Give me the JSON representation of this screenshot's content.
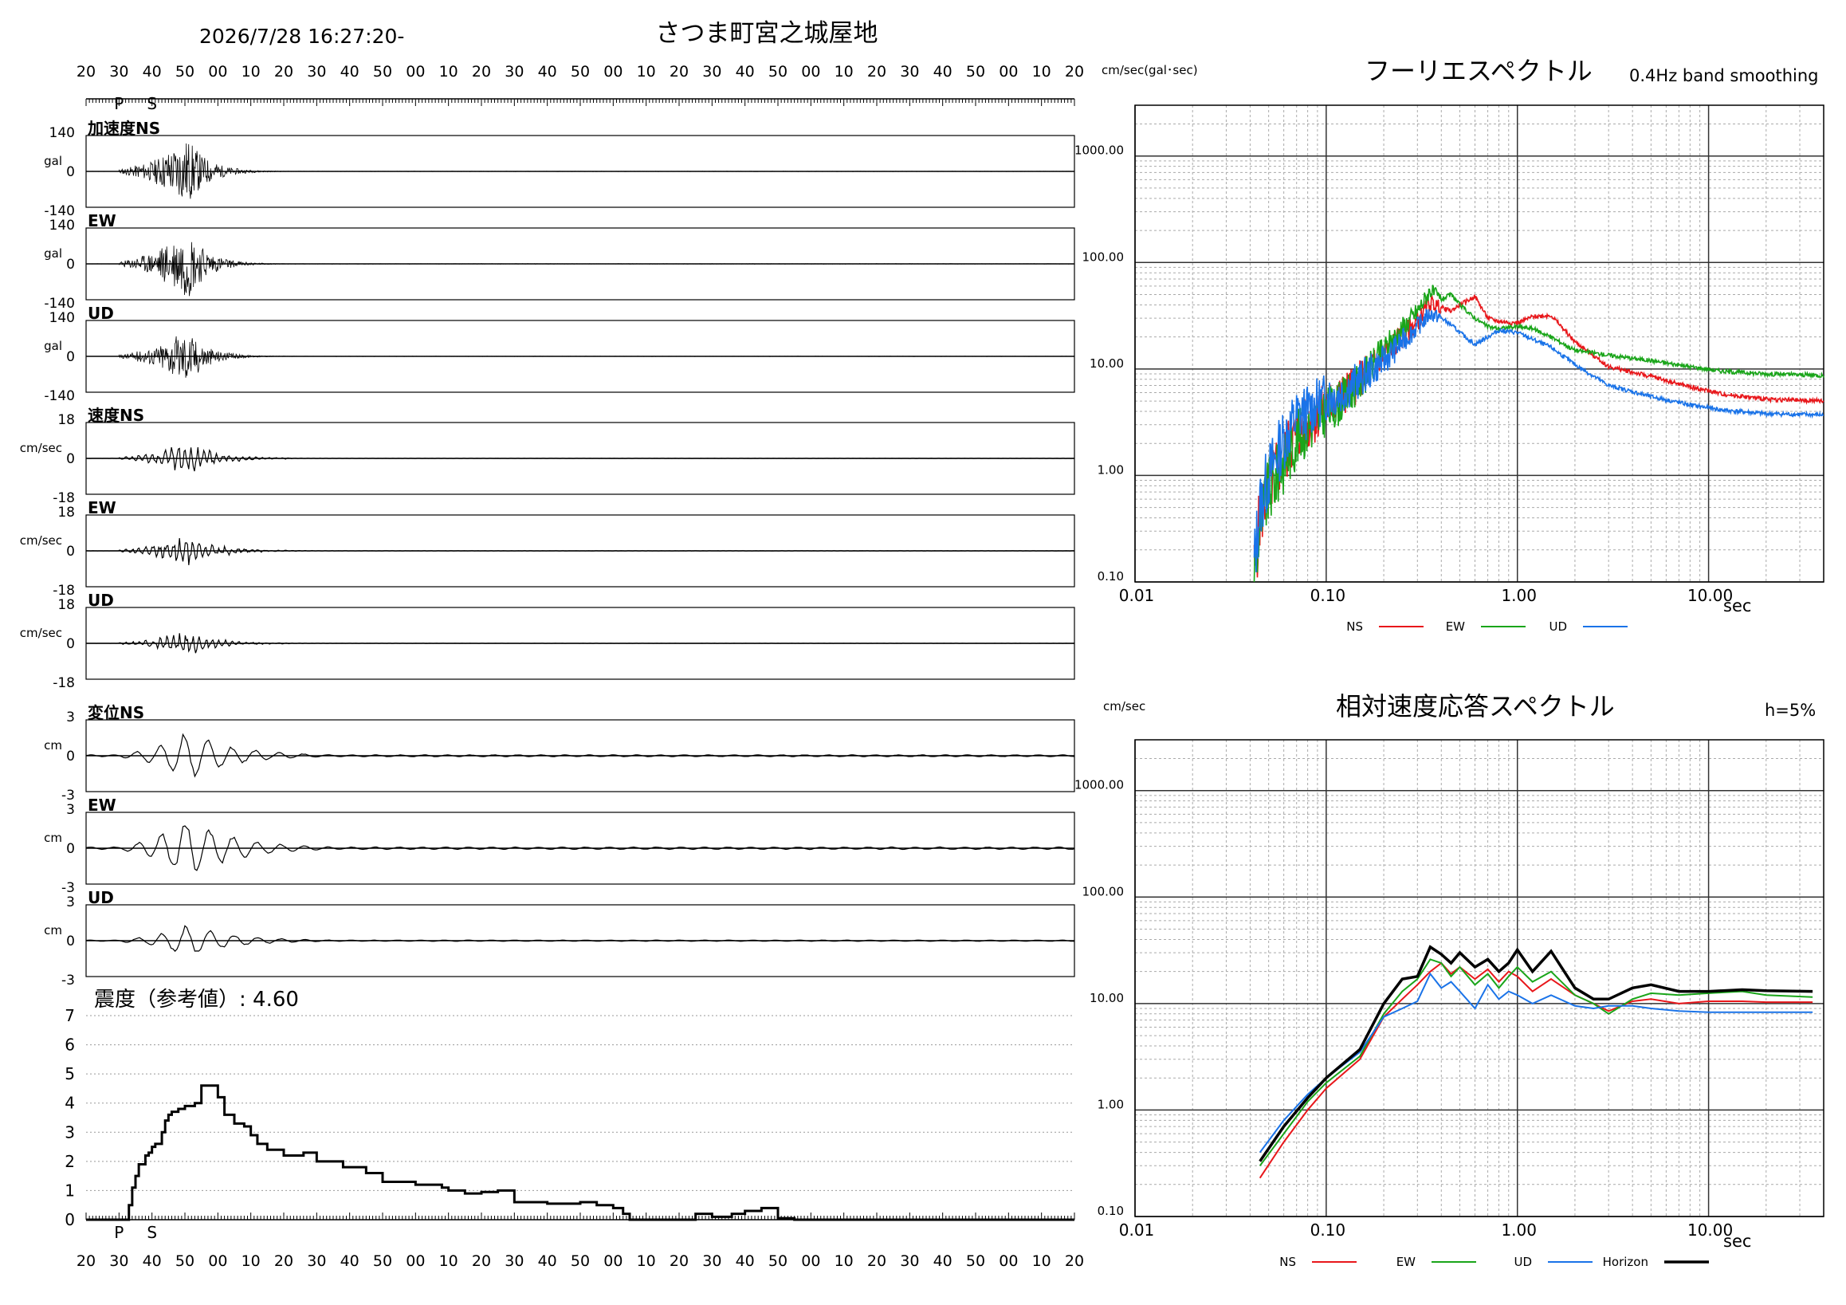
{
  "header": {
    "datetime": "2026/7/28 16:27:20-",
    "station": "さつま町宮之城屋地"
  },
  "colors": {
    "ns": "#e8171b",
    "ew": "#1aa51a",
    "ud": "#1a73e8",
    "horizon": "#000000",
    "ps_marker": "#1a73e8"
  },
  "time_axis": {
    "ticks": [
      "20",
      "30",
      "40",
      "50",
      "00",
      "10",
      "20",
      "30",
      "40",
      "50",
      "00",
      "10",
      "20",
      "30",
      "40",
      "50",
      "00",
      "10",
      "20",
      "30",
      "40",
      "50",
      "00",
      "10",
      "20",
      "30",
      "40",
      "50",
      "00",
      "10",
      "20"
    ],
    "p_label": "P",
    "s_label": "S"
  },
  "chart_data": [
    {
      "type": "line",
      "id": "waveforms",
      "panels": [
        {
          "label": "加速度NS",
          "unit": "gal",
          "max": "140",
          "zero": "0",
          "min": "-140",
          "kind": "acc",
          "amp": 1.0,
          "seed": 11
        },
        {
          "label": "EW",
          "unit": "gal",
          "max": "140",
          "zero": "0",
          "min": "-140",
          "kind": "acc",
          "amp": 1.05,
          "seed": 23
        },
        {
          "label": "UD",
          "unit": "gal",
          "max": "140",
          "zero": "0",
          "min": "-140",
          "kind": "acc",
          "amp": 0.8,
          "seed": 37
        },
        {
          "label": "速度NS",
          "unit": "cm/sec",
          "max": "18",
          "zero": "0",
          "min": "-18",
          "kind": "vel",
          "amp": 0.55,
          "seed": 41
        },
        {
          "label": "EW",
          "unit": "cm/sec",
          "max": "18",
          "zero": "0",
          "min": "-18",
          "kind": "vel",
          "amp": 0.55,
          "seed": 53
        },
        {
          "label": "UD",
          "unit": "cm/sec",
          "max": "18",
          "zero": "0",
          "min": "-18",
          "kind": "vel",
          "amp": 0.4,
          "seed": 67
        },
        {
          "label": "変位NS",
          "unit": "cm",
          "max": "3",
          "zero": "0",
          "min": "-3",
          "kind": "disp",
          "amp": 0.75,
          "seed": 71
        },
        {
          "label": "EW",
          "unit": "cm",
          "max": "3",
          "zero": "0",
          "min": "-3",
          "kind": "disp",
          "amp": 0.95,
          "seed": 83
        },
        {
          "label": "UD",
          "unit": "cm",
          "max": "3",
          "zero": "0",
          "min": "-3",
          "kind": "disp",
          "amp": 0.5,
          "seed": 97
        }
      ]
    },
    {
      "type": "line",
      "id": "intensity",
      "title": "震度（参考値）: 4.60",
      "ylim": [
        0,
        7
      ],
      "yticks": [
        "0",
        "1",
        "2",
        "3",
        "4",
        "5",
        "6",
        "7"
      ],
      "x_seconds": [
        0,
        11,
        13,
        14,
        15,
        16,
        18,
        19,
        20,
        21,
        22,
        23,
        24,
        25,
        26,
        28,
        30,
        33,
        35,
        36,
        37,
        40,
        42,
        45,
        48,
        50,
        52,
        55,
        60,
        66,
        70,
        78,
        85,
        90,
        100,
        108,
        110,
        115,
        120,
        125,
        130,
        140,
        150,
        155,
        160,
        163,
        165,
        170,
        175,
        180,
        185,
        190,
        196,
        200,
        205,
        210,
        215,
        220,
        300
      ],
      "values": [
        0,
        0,
        0.5,
        1.1,
        1.5,
        1.9,
        2.2,
        2.3,
        2.5,
        2.6,
        2.6,
        3.0,
        3.4,
        3.6,
        3.7,
        3.8,
        3.9,
        4.0,
        4.6,
        4.6,
        4.6,
        4.2,
        3.6,
        3.3,
        3.2,
        2.9,
        2.6,
        2.4,
        2.2,
        2.3,
        2.0,
        1.8,
        1.6,
        1.3,
        1.2,
        1.1,
        1.0,
        0.9,
        0.95,
        1.0,
        0.6,
        0.55,
        0.6,
        0.5,
        0.4,
        0.2,
        0.0,
        0.0,
        0.0,
        0.0,
        0.2,
        0.1,
        0.2,
        0.3,
        0.4,
        0.05,
        0.0,
        0.0,
        0.0
      ]
    },
    {
      "type": "line",
      "id": "fourier",
      "title": "フーリエスペクトル",
      "subtitle": "0.4Hz band smoothing",
      "ylabel": "cm/sec(gal･sec)",
      "xlabel": "sec",
      "log_x": true,
      "log_y": true,
      "xlim": [
        0.01,
        40
      ],
      "ylim": [
        0.1,
        3000
      ],
      "xticks": [
        {
          "v": 0.01,
          "label": "0.01"
        },
        {
          "v": 0.1,
          "label": "0.10"
        },
        {
          "v": 1,
          "label": "1.00"
        },
        {
          "v": 10,
          "label": "10.00"
        }
      ],
      "yticks": [
        {
          "v": 0.1,
          "label": "0.10"
        },
        {
          "v": 1,
          "label": "1.00"
        },
        {
          "v": 10,
          "label": "10.00"
        },
        {
          "v": 100,
          "label": "100.00"
        },
        {
          "v": 1000,
          "label": "1000.00"
        }
      ],
      "series": [
        {
          "name": "NS",
          "color": "#e8171b",
          "noise": 0.35,
          "seed": 5,
          "x": [
            0.042,
            0.045,
            0.05,
            0.06,
            0.07,
            0.08,
            0.1,
            0.12,
            0.15,
            0.2,
            0.25,
            0.3,
            0.35,
            0.4,
            0.45,
            0.5,
            0.6,
            0.7,
            0.8,
            1.0,
            1.2,
            1.5,
            2.0,
            3.0,
            5.0,
            8.0,
            12.0,
            20.0,
            40.0
          ],
          "y": [
            0.12,
            0.4,
            0.8,
            1.5,
            2.5,
            3.0,
            4.5,
            5.5,
            8.0,
            14,
            20,
            28,
            42,
            38,
            35,
            40,
            48,
            30,
            28,
            27,
            31,
            32,
            18,
            10.5,
            8.5,
            6.8,
            5.8,
            5.2,
            5.0
          ]
        },
        {
          "name": "EW",
          "color": "#1aa51a",
          "noise": 0.35,
          "seed": 9,
          "x": [
            0.042,
            0.045,
            0.05,
            0.06,
            0.07,
            0.08,
            0.1,
            0.12,
            0.15,
            0.2,
            0.25,
            0.3,
            0.35,
            0.4,
            0.45,
            0.5,
            0.6,
            0.7,
            0.8,
            1.0,
            1.2,
            1.5,
            2.0,
            3.0,
            5.0,
            8.0,
            12.0,
            20.0,
            40.0
          ],
          "y": [
            0.12,
            0.35,
            0.7,
            1.3,
            2.2,
            2.8,
            4.0,
            5.0,
            7.5,
            15,
            24,
            35,
            55,
            45,
            50,
            40,
            30,
            25,
            24,
            25,
            24,
            20,
            15,
            13.5,
            12,
            10.5,
            9.5,
            9.0,
            8.7
          ]
        },
        {
          "name": "UD",
          "color": "#1a73e8",
          "noise": 0.35,
          "seed": 13,
          "x": [
            0.042,
            0.045,
            0.05,
            0.06,
            0.07,
            0.08,
            0.1,
            0.12,
            0.15,
            0.2,
            0.25,
            0.3,
            0.35,
            0.4,
            0.45,
            0.5,
            0.6,
            0.7,
            0.8,
            1.0,
            1.2,
            1.5,
            2.0,
            3.0,
            5.0,
            8.0,
            12.0,
            20.0,
            40.0
          ],
          "y": [
            0.15,
            0.5,
            1.0,
            2.2,
            3.5,
            4.0,
            5.5,
            6.0,
            8.0,
            12,
            18,
            25,
            33,
            30,
            26,
            22,
            17,
            20,
            23,
            22,
            19,
            16,
            11,
            7,
            5.5,
            4.6,
            4.1,
            3.8,
            3.7
          ]
        }
      ]
    },
    {
      "type": "line",
      "id": "response",
      "title": "相対速度応答スペクトル",
      "subtitle": "h=5%",
      "ylabel": "cm/sec",
      "xlabel": "sec",
      "log_x": true,
      "log_y": true,
      "xlim": [
        0.01,
        40
      ],
      "ylim": [
        0.1,
        3000
      ],
      "xticks": [
        {
          "v": 0.01,
          "label": "0.01"
        },
        {
          "v": 0.1,
          "label": "0.10"
        },
        {
          "v": 1,
          "label": "1.00"
        },
        {
          "v": 10,
          "label": "10.00"
        }
      ],
      "yticks": [
        {
          "v": 0.1,
          "label": "0.10"
        },
        {
          "v": 1,
          "label": "1.00"
        },
        {
          "v": 10,
          "label": "10.00"
        },
        {
          "v": 100,
          "label": "100.00"
        },
        {
          "v": 1000,
          "label": "1000.00"
        }
      ],
      "series": [
        {
          "name": "NS",
          "color": "#e8171b",
          "width": 2,
          "x": [
            0.045,
            0.06,
            0.08,
            0.1,
            0.15,
            0.2,
            0.25,
            0.3,
            0.35,
            0.4,
            0.45,
            0.5,
            0.6,
            0.7,
            0.8,
            0.9,
            1.0,
            1.2,
            1.5,
            2.0,
            2.5,
            3.0,
            4.0,
            5.0,
            7.0,
            10.0,
            15.0,
            20.0,
            35.0
          ],
          "y": [
            0.23,
            0.5,
            1.0,
            1.6,
            3.0,
            7.5,
            11,
            15,
            20,
            24,
            19,
            22,
            17,
            21,
            16,
            20,
            18,
            13,
            17,
            12,
            10,
            8.5,
            10.5,
            11,
            10,
            10.5,
            10.5,
            10.3,
            10.3
          ]
        },
        {
          "name": "EW",
          "color": "#1aa51a",
          "width": 2,
          "x": [
            0.045,
            0.06,
            0.08,
            0.1,
            0.15,
            0.2,
            0.25,
            0.3,
            0.35,
            0.4,
            0.45,
            0.5,
            0.6,
            0.7,
            0.8,
            0.9,
            1.0,
            1.2,
            1.5,
            2.0,
            2.5,
            3.0,
            4.0,
            5.0,
            7.0,
            10.0,
            15.0,
            20.0,
            35.0
          ],
          "y": [
            0.3,
            0.6,
            1.2,
            1.8,
            3.2,
            8.0,
            13,
            17,
            26,
            24,
            18,
            22,
            15,
            19,
            14,
            18,
            22,
            16,
            20,
            12,
            10,
            8.0,
            11,
            12.5,
            12,
            12.5,
            13,
            12,
            11.5
          ]
        },
        {
          "name": "UD",
          "color": "#1a73e8",
          "width": 2,
          "x": [
            0.045,
            0.06,
            0.08,
            0.1,
            0.15,
            0.2,
            0.25,
            0.3,
            0.35,
            0.4,
            0.45,
            0.5,
            0.6,
            0.7,
            0.8,
            0.9,
            1.0,
            1.2,
            1.5,
            2.0,
            2.5,
            3.0,
            4.0,
            5.0,
            7.0,
            10.0,
            15.0,
            20.0,
            35.0
          ],
          "y": [
            0.4,
            0.8,
            1.4,
            2.0,
            3.5,
            7.5,
            9,
            10.5,
            19,
            14,
            16,
            13,
            9,
            15,
            11,
            13,
            12,
            10,
            12,
            9.5,
            9,
            9.5,
            9.5,
            9.0,
            8.5,
            8.3,
            8.3,
            8.3,
            8.3
          ]
        },
        {
          "name": "Horizon",
          "color": "#000000",
          "width": 3.5,
          "x": [
            0.045,
            0.06,
            0.08,
            0.1,
            0.15,
            0.2,
            0.25,
            0.3,
            0.35,
            0.4,
            0.45,
            0.5,
            0.6,
            0.7,
            0.8,
            0.9,
            1.0,
            1.2,
            1.5,
            2.0,
            2.5,
            3.0,
            4.0,
            5.0,
            7.0,
            10.0,
            15.0,
            20.0,
            35.0
          ],
          "y": [
            0.33,
            0.7,
            1.3,
            2.0,
            3.7,
            10,
            17,
            18,
            34,
            29,
            24,
            30,
            22,
            26,
            20,
            24,
            32,
            20,
            31,
            14,
            11,
            11,
            14,
            15,
            13,
            13,
            13.5,
            13.2,
            13.0
          ]
        }
      ]
    }
  ]
}
